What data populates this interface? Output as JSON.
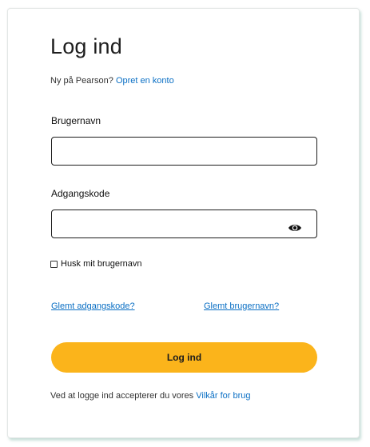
{
  "login": {
    "title": "Log ind",
    "new_user_text": "Ny på Pearson?",
    "create_account_link": "Opret en konto",
    "username_label": "Brugernavn",
    "username_value": "",
    "password_label": "Adgangskode",
    "password_value": "",
    "show_password_icon": "eye-icon",
    "remember_label": "Husk mit brugernavn",
    "remember_checked": false,
    "forgot_password_link": "Glemt adgangskode?",
    "forgot_username_link": "Glemt brugernavn?",
    "submit_label": "Log ind",
    "terms_text": "Ved at logge ind accepterer du vores",
    "terms_link": "Vilkår for brug"
  },
  "colors": {
    "accent_button": "#fbb41b",
    "link": "#0a6fc4",
    "card_shadow": "#a0c8be"
  }
}
